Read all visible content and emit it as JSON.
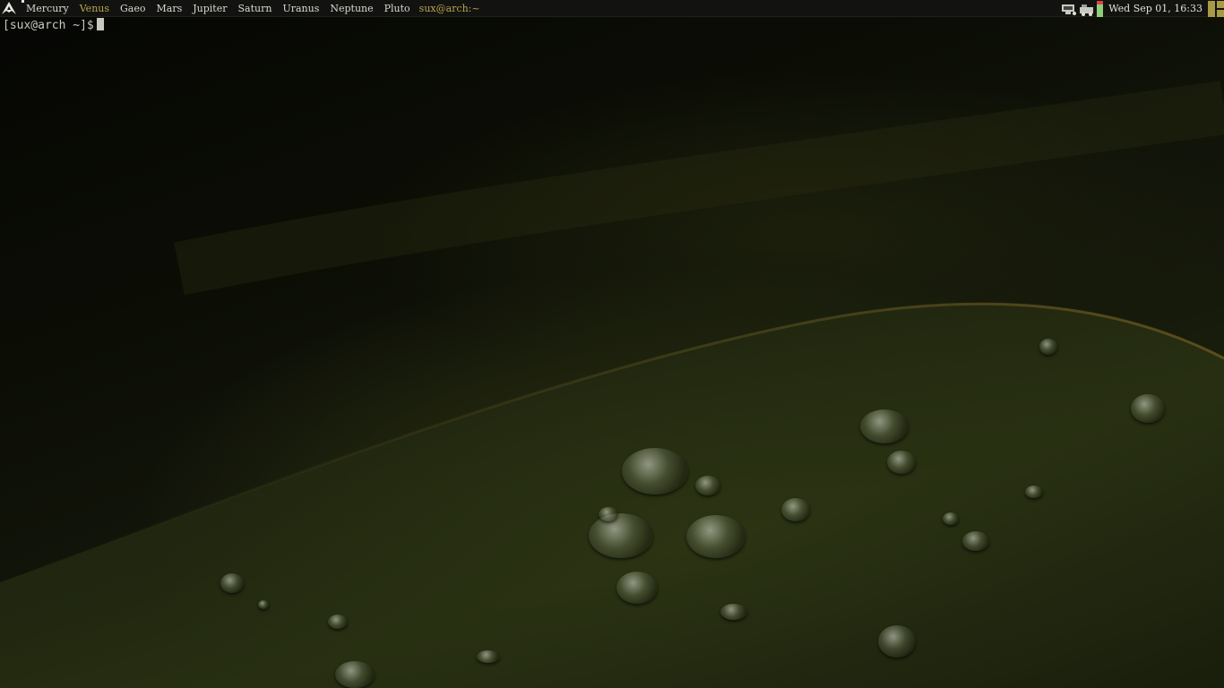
{
  "panel": {
    "logo_icon": "arch-logo-icon",
    "workspaces": [
      {
        "label": "Mercury",
        "state": "occupied"
      },
      {
        "label": "Venus",
        "state": "active"
      },
      {
        "label": "Gaeo",
        "state": "normal"
      },
      {
        "label": "Mars",
        "state": "normal"
      },
      {
        "label": "Jupiter",
        "state": "normal"
      },
      {
        "label": "Saturn",
        "state": "normal"
      },
      {
        "label": "Uranus",
        "state": "normal"
      },
      {
        "label": "Neptune",
        "state": "normal"
      },
      {
        "label": "Pluto",
        "state": "normal"
      }
    ],
    "window_title": "sux@arch:~",
    "tray_icons": [
      "network-icon",
      "usb-drive-icon",
      "battery-icon"
    ],
    "clock": "Wed Sep 01, 16:33",
    "layout_icon": "tile-layout-icon",
    "colors": {
      "panel_bg": "#121310",
      "accent": "#b9a34f",
      "text": "#d8d8d0",
      "battery_ok": "#8ed07a",
      "battery_low": "#dd4444"
    }
  },
  "terminal": {
    "prompt": "[sux@arch ~]$"
  },
  "wallpaper": {
    "description_icon": "leaf-with-water-drops-wallpaper"
  }
}
